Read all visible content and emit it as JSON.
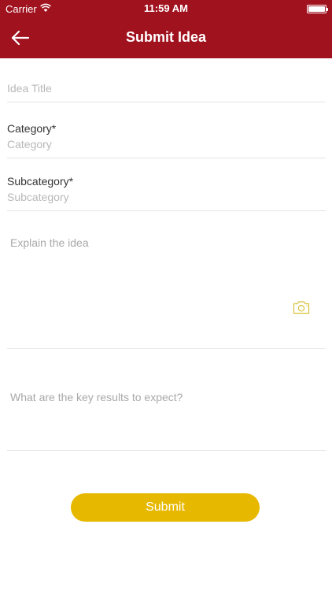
{
  "status_bar": {
    "carrier": "Carrier",
    "time": "11:59 AM"
  },
  "nav": {
    "title": "Submit Idea",
    "back_icon": "arrow-left-icon"
  },
  "form": {
    "idea_title": {
      "placeholder": "Idea Title",
      "value": ""
    },
    "category": {
      "label": "Category*",
      "placeholder": "Category",
      "value": ""
    },
    "subcategory": {
      "label": "Subcategory*",
      "placeholder": "Subcategory",
      "value": ""
    },
    "explanation": {
      "placeholder": "Explain the idea",
      "value": ""
    },
    "key_results": {
      "placeholder": "What are the key results to expect?",
      "value": ""
    },
    "camera_icon": "camera-icon",
    "submit_label": "Submit"
  },
  "colors": {
    "header": "#a1121f",
    "accent": "#e6b800",
    "camera": "#d8c23a",
    "divider": "#e4e4e4",
    "placeholder": "#b8b8b8"
  }
}
